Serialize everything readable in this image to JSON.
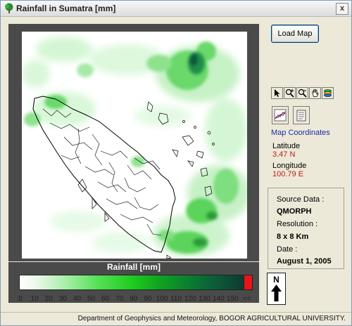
{
  "window": {
    "title": "Rainfall in Sumatra [mm]",
    "close_label": "x"
  },
  "map": {
    "title": "Rainfall [mm]"
  },
  "legend": {
    "ticks": [
      "0",
      "10",
      "20",
      "30",
      "40",
      "50",
      "60",
      "70",
      "80",
      "90",
      "100",
      "110",
      "120",
      "130",
      "140",
      "150",
      "<<"
    ]
  },
  "compass": {
    "label": "N"
  },
  "controls": {
    "load_map_label": "Load Map"
  },
  "coordinates": {
    "title": "Map Coordinates",
    "latitude_label": "Latitude",
    "latitude_value": "3.47  N",
    "longitude_label": "Longitude",
    "longitude_value": "100.79  E"
  },
  "source": {
    "source_label": "Source Data :",
    "source_value": "QMORPH",
    "resolution_label": "Resolution :",
    "resolution_value": "8 x 8 Km",
    "date_label": "Date :",
    "date_value": "August 1, 2005"
  },
  "footer": {
    "text": "Department of Geophysics and Meteorology, BOGOR AGRICULTURAL UNIVERSITY."
  },
  "colors": {
    "rain_light": "#b6f0b6",
    "rain_medium": "#33cc33",
    "rain_heavy": "#0b5a3a",
    "legend_overflow": "#e8141c",
    "coord_value": "#c01818",
    "coord_title": "#1a2ca8"
  }
}
